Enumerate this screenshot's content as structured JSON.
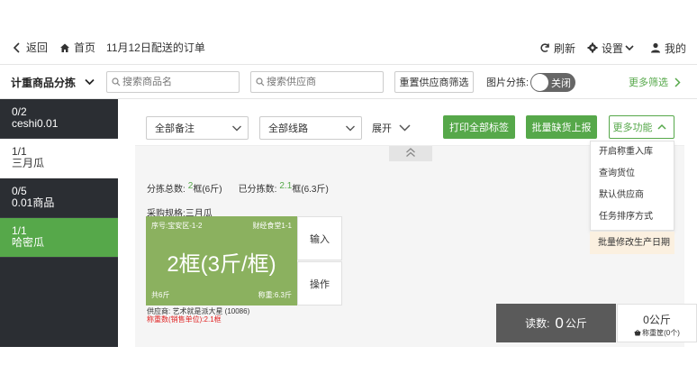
{
  "nav": {
    "back": "返回",
    "home": "首页",
    "title": "11月12日配送的订单",
    "refresh": "刷新",
    "settings": "设置",
    "mine": "我的"
  },
  "filters": {
    "category_title": "计重商品分拣",
    "search_product_placeholder": "搜索商品名",
    "search_supplier_placeholder": "搜索供应商",
    "reset_supplier": "重置供应商筛选",
    "picture_sorting_label": "图片分拣:",
    "toggle_state": "关闭",
    "more_filters": "更多筛选"
  },
  "sidebar": {
    "items": [
      {
        "count": "0/2",
        "name": "ceshi0.01"
      },
      {
        "count": "1/1",
        "name": "三月瓜"
      },
      {
        "count": "0/5",
        "name": "0.01商品"
      },
      {
        "count": "1/1",
        "name": "哈密瓜"
      }
    ]
  },
  "controls": {
    "all_remarks": "全部备注",
    "all_routes": "全部线路",
    "expand": "展开",
    "print_all_labels": "打印全部标签",
    "batch_report_shortage": "批量缺货上报",
    "more_functions": "更多功能"
  },
  "more_menu": {
    "items": [
      "开启称重入库",
      "查询货位",
      "默认供应商",
      "任务排序方式"
    ],
    "extra": "批量修改生产日期"
  },
  "summary": {
    "total_label": "分拣总数:",
    "total_value": "2",
    "total_unit": "框(6斤)",
    "sorted_label": "已分拣数:",
    "sorted_value": "2.1",
    "sorted_unit": "框(6.3斤)"
  },
  "spec": "采购规格:三月瓜",
  "card": {
    "seq": "序号:宝安区-1-2",
    "customer": "财经食堂1-1",
    "amount": "2框(3斤/框)",
    "total": "共6斤",
    "weighed": "称重:6.3斤"
  },
  "card_buttons": {
    "input": "输入",
    "operate": "操作"
  },
  "supplier_text": "供应商: 艺术就是派大星 (10086)",
  "weight_sale_text": "称重数(销售单位):2.1框",
  "scale": {
    "reading_label": "读数:",
    "reading_value": "0",
    "reading_unit": "公斤",
    "tare_value": "0公斤",
    "tare_label": "称重筐(0个)"
  }
}
